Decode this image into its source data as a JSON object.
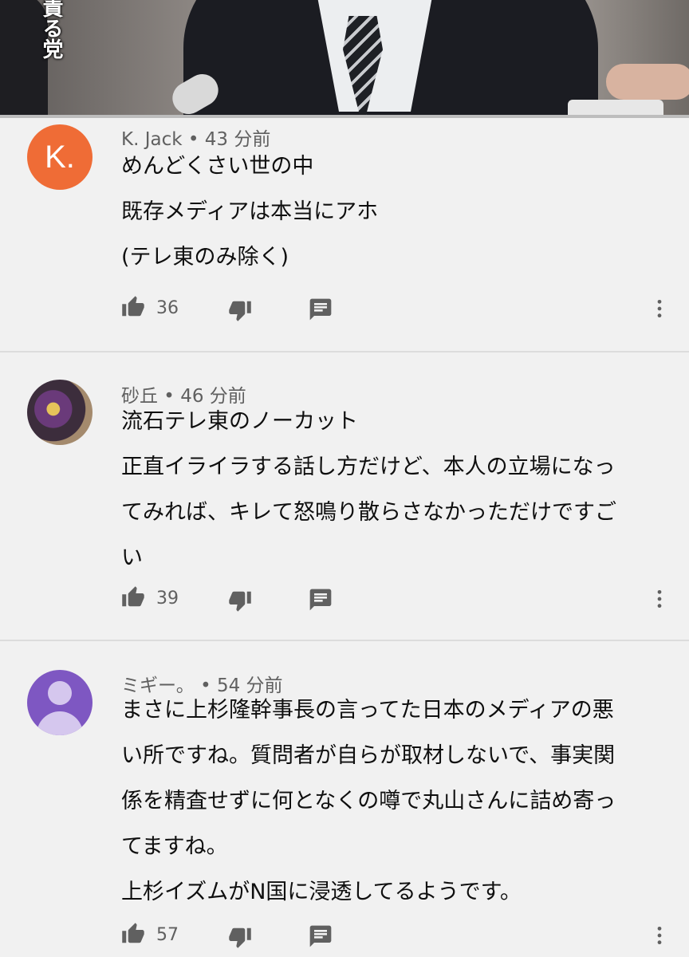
{
  "video": {
    "caption": "責る党"
  },
  "comments": [
    {
      "author": "K. Jack",
      "time": "43 分前",
      "meta": "K. Jack • 43 分前",
      "avatar_letter": "K.",
      "avatar_color": "#ef6c36",
      "lines": [
        "めんどくさい世の中",
        "既存メディアは本当にアホ",
        "(テレ東のみ除く)"
      ],
      "likes": "36"
    },
    {
      "author": "砂丘",
      "time": "46 分前",
      "meta": "砂丘 • 46 分前",
      "lines": [
        "流石テレ東のノーカット",
        "正直イライラする話し方だけど、本人の立場になっ",
        "てみれば、キレて怒鳴り散らさなかっただけですご",
        "い"
      ],
      "likes": "39"
    },
    {
      "author": "ミギー。",
      "time": "54 分前",
      "meta": "ミギー。 • 54 分前",
      "avatar_color": "#7e57c2",
      "lines": [
        "まさに上杉隆幹事長の言ってた日本のメディアの悪",
        "い所ですね。質問者が自らが取材しないで、事実関",
        "係を精査せずに何となくの噂で丸山さんに詰め寄っ",
        "てますね。",
        "上杉イズムがN国に浸透してるようです。"
      ],
      "likes": "57"
    }
  ],
  "colors": {
    "background": "#f1f1f1",
    "meta": "#606060",
    "progress": "#e62117"
  },
  "icons": [
    "thumb-up-icon",
    "thumb-down-icon",
    "reply-icon",
    "more-vert-icon"
  ]
}
